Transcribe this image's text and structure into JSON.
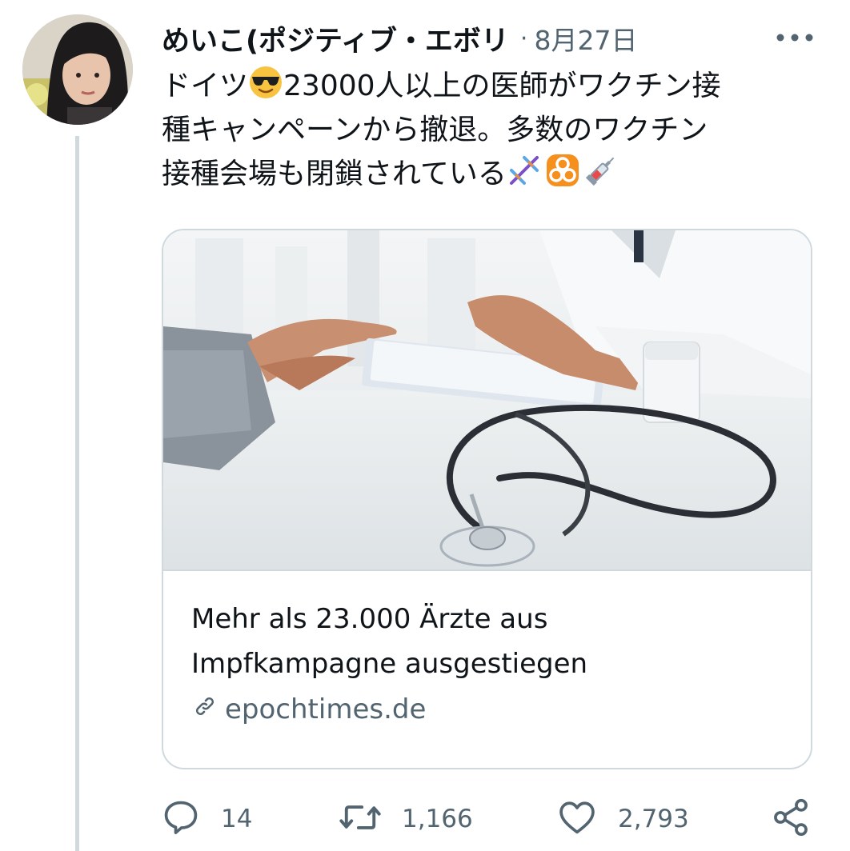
{
  "tweet": {
    "display_name": "めいこ(ポジティブ・エボリ",
    "separator": "·",
    "date": "8月27日",
    "text_lines": [
      {
        "before": "ドイツ",
        "emoji": "smiling-face-with-sunglasses",
        "after": "23000人以上の医師がワクチン接"
      },
      {
        "before": "種キャンペーンから撤退。多数のワクチン"
      },
      {
        "before": "接種会場も閉鎖されている",
        "trailing_emojis": [
          "dna",
          "biohazard",
          "syringe"
        ]
      }
    ]
  },
  "card": {
    "title_line1": "Mehr als 23.000 Ärzte aus",
    "title_line2": "Impfkampagne ausgestiegen",
    "domain": "epochtimes.de",
    "image": "doctor-consultation-stethoscope-photo"
  },
  "actions": {
    "reply_count": "14",
    "retweet_count": "1,166",
    "like_count": "2,793"
  },
  "colors": {
    "text_primary": "#0f1419",
    "text_secondary": "#536471",
    "border": "#cfd9de"
  },
  "icons": [
    "more-horizontal-icon",
    "reply-icon",
    "retweet-icon",
    "like-icon",
    "share-icon",
    "link-icon"
  ]
}
